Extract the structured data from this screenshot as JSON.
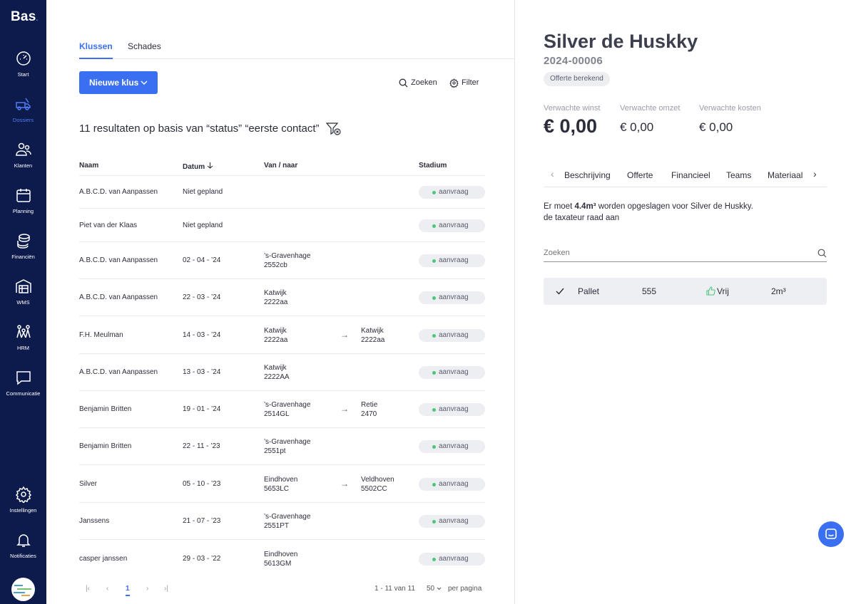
{
  "app": {
    "logo": "Bas",
    "logo_dot": "."
  },
  "sidebar": {
    "items": [
      {
        "label": "Start"
      },
      {
        "label": "Dossiers"
      },
      {
        "label": "Klanten"
      },
      {
        "label": "Planning"
      },
      {
        "label": "Financiën"
      },
      {
        "label": "WMS"
      },
      {
        "label": "HRM"
      },
      {
        "label": "Communicatie"
      },
      {
        "label": "Instellingen"
      },
      {
        "label": "Notificaties"
      }
    ],
    "active": "Dossiers"
  },
  "list": {
    "tabs": [
      "Klussen",
      "Schades"
    ],
    "new_button": "Nieuwe klus",
    "search_label": "Zoeken",
    "filter_label": "Filter",
    "results_text": "11 resultaten op basis van “status” “eerste contact”",
    "columns": [
      "Naam",
      "Datum",
      "Van / naar",
      "Stadium"
    ],
    "rows": [
      {
        "name": "A.B.C.D. van Aanpassen",
        "date": "Niet gepland",
        "from1": "",
        "from2": "",
        "to1": "",
        "to2": "",
        "stage": "aanvraag"
      },
      {
        "name": "Piet van der Klaas",
        "date": "Niet gepland",
        "from1": "",
        "from2": "",
        "to1": "",
        "to2": "",
        "stage": "aanvraag"
      },
      {
        "name": "A.B.C.D. van Aanpassen",
        "date": "02 - 04 - ’24",
        "from1": "’s-Gravenhage",
        "from2": "2552cb",
        "to1": "",
        "to2": "",
        "stage": "aanvraag"
      },
      {
        "name": "A.B.C.D. van Aanpassen",
        "date": "22 - 03 - ’24",
        "from1": "Katwijk",
        "from2": "2222aa",
        "to1": "",
        "to2": "",
        "stage": "aanvraag"
      },
      {
        "name": "F.H. Meulman",
        "date": "14 - 03 - ’24",
        "from1": "Katwijk",
        "from2": "2222aa",
        "to1": "Katwijk",
        "to2": "2222aa",
        "stage": "aanvraag"
      },
      {
        "name": "A.B.C.D. van Aanpassen",
        "date": "13 - 03 - ’24",
        "from1": "Katwijk",
        "from2": "2222AA",
        "to1": "",
        "to2": "",
        "stage": "aanvraag"
      },
      {
        "name": "Benjamin Britten",
        "date": "19 - 01 - ’24",
        "from1": "’s-Gravenhage",
        "from2": "2514GL",
        "to1": "Retie",
        "to2": "2470",
        "stage": "aanvraag"
      },
      {
        "name": "Benjamin Britten",
        "date": "22 - 11 - ’23",
        "from1": "’s-Gravenhage",
        "from2": "2551pt",
        "to1": "",
        "to2": "",
        "stage": "aanvraag"
      },
      {
        "name": "Silver",
        "date": "05 - 10 - ’23",
        "from1": "Eindhoven",
        "from2": "5653LC",
        "to1": "Veldhoven",
        "to2": "5502CC",
        "stage": "aanvraag"
      },
      {
        "name": "Janssens",
        "date": "21 - 07 - ’23",
        "from1": "’s-Gravenhage",
        "from2": "2551PT",
        "to1": "",
        "to2": "",
        "stage": "aanvraag"
      },
      {
        "name": "casper janssen",
        "date": "29 - 03 - ’22",
        "from1": "Eindhoven",
        "from2": "5613GM",
        "to1": "",
        "to2": "",
        "stage": "aanvraag"
      }
    ],
    "pagination": {
      "current_page": "1",
      "range_text": "1 - 11 van 11",
      "per_page": "50",
      "per_page_label": "per pagina"
    }
  },
  "detail": {
    "title": "Silver de Huskky",
    "number": "2024-00006",
    "status": "Offerte berekend",
    "metrics": {
      "winst_label": "Verwachte winst",
      "winst": "€ 0,00",
      "omzet_label": "Verwachte omzet",
      "omzet": "€ 0,00",
      "kosten_label": "Verwachte kosten",
      "kosten": "€ 0,00"
    },
    "tabs": [
      "Beschrijving",
      "Offerte",
      "Financieel",
      "Teams",
      "Materiaal"
    ],
    "description": {
      "pre": "Er moet ",
      "amount": "4.4m³",
      "post": " worden opgeslagen voor Silver de Huskky.",
      "line2": "de taxateur raad aan"
    },
    "search_placeholder": "Zoeken",
    "items": [
      {
        "name": "Pallet",
        "qty": "555",
        "status": "Vrij",
        "volume": "2m³"
      }
    ]
  }
}
